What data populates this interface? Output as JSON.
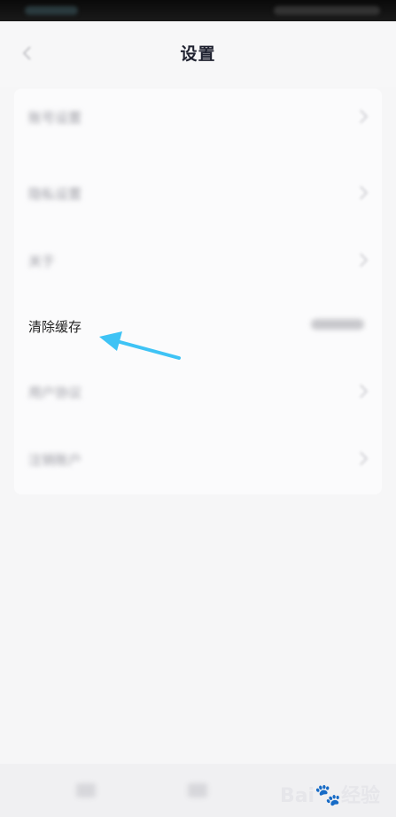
{
  "header": {
    "title": "设置"
  },
  "settings": {
    "items": [
      {
        "label": "账号设置"
      },
      {
        "label": "隐私设置"
      },
      {
        "label": "关于"
      },
      {
        "label": "清除缓存"
      },
      {
        "label": "用户协议"
      },
      {
        "label": "注销账户"
      }
    ]
  },
  "watermark": {
    "text": "Bai",
    "suffix": "经验"
  },
  "colors": {
    "arrow": "#3ec3f5",
    "background": "#f6f6f7",
    "card": "#fbfbfc"
  },
  "icons": {
    "back": "back-arrow-icon",
    "chevron": "chevron-right-icon",
    "annotation": "pointer-arrow-icon"
  }
}
